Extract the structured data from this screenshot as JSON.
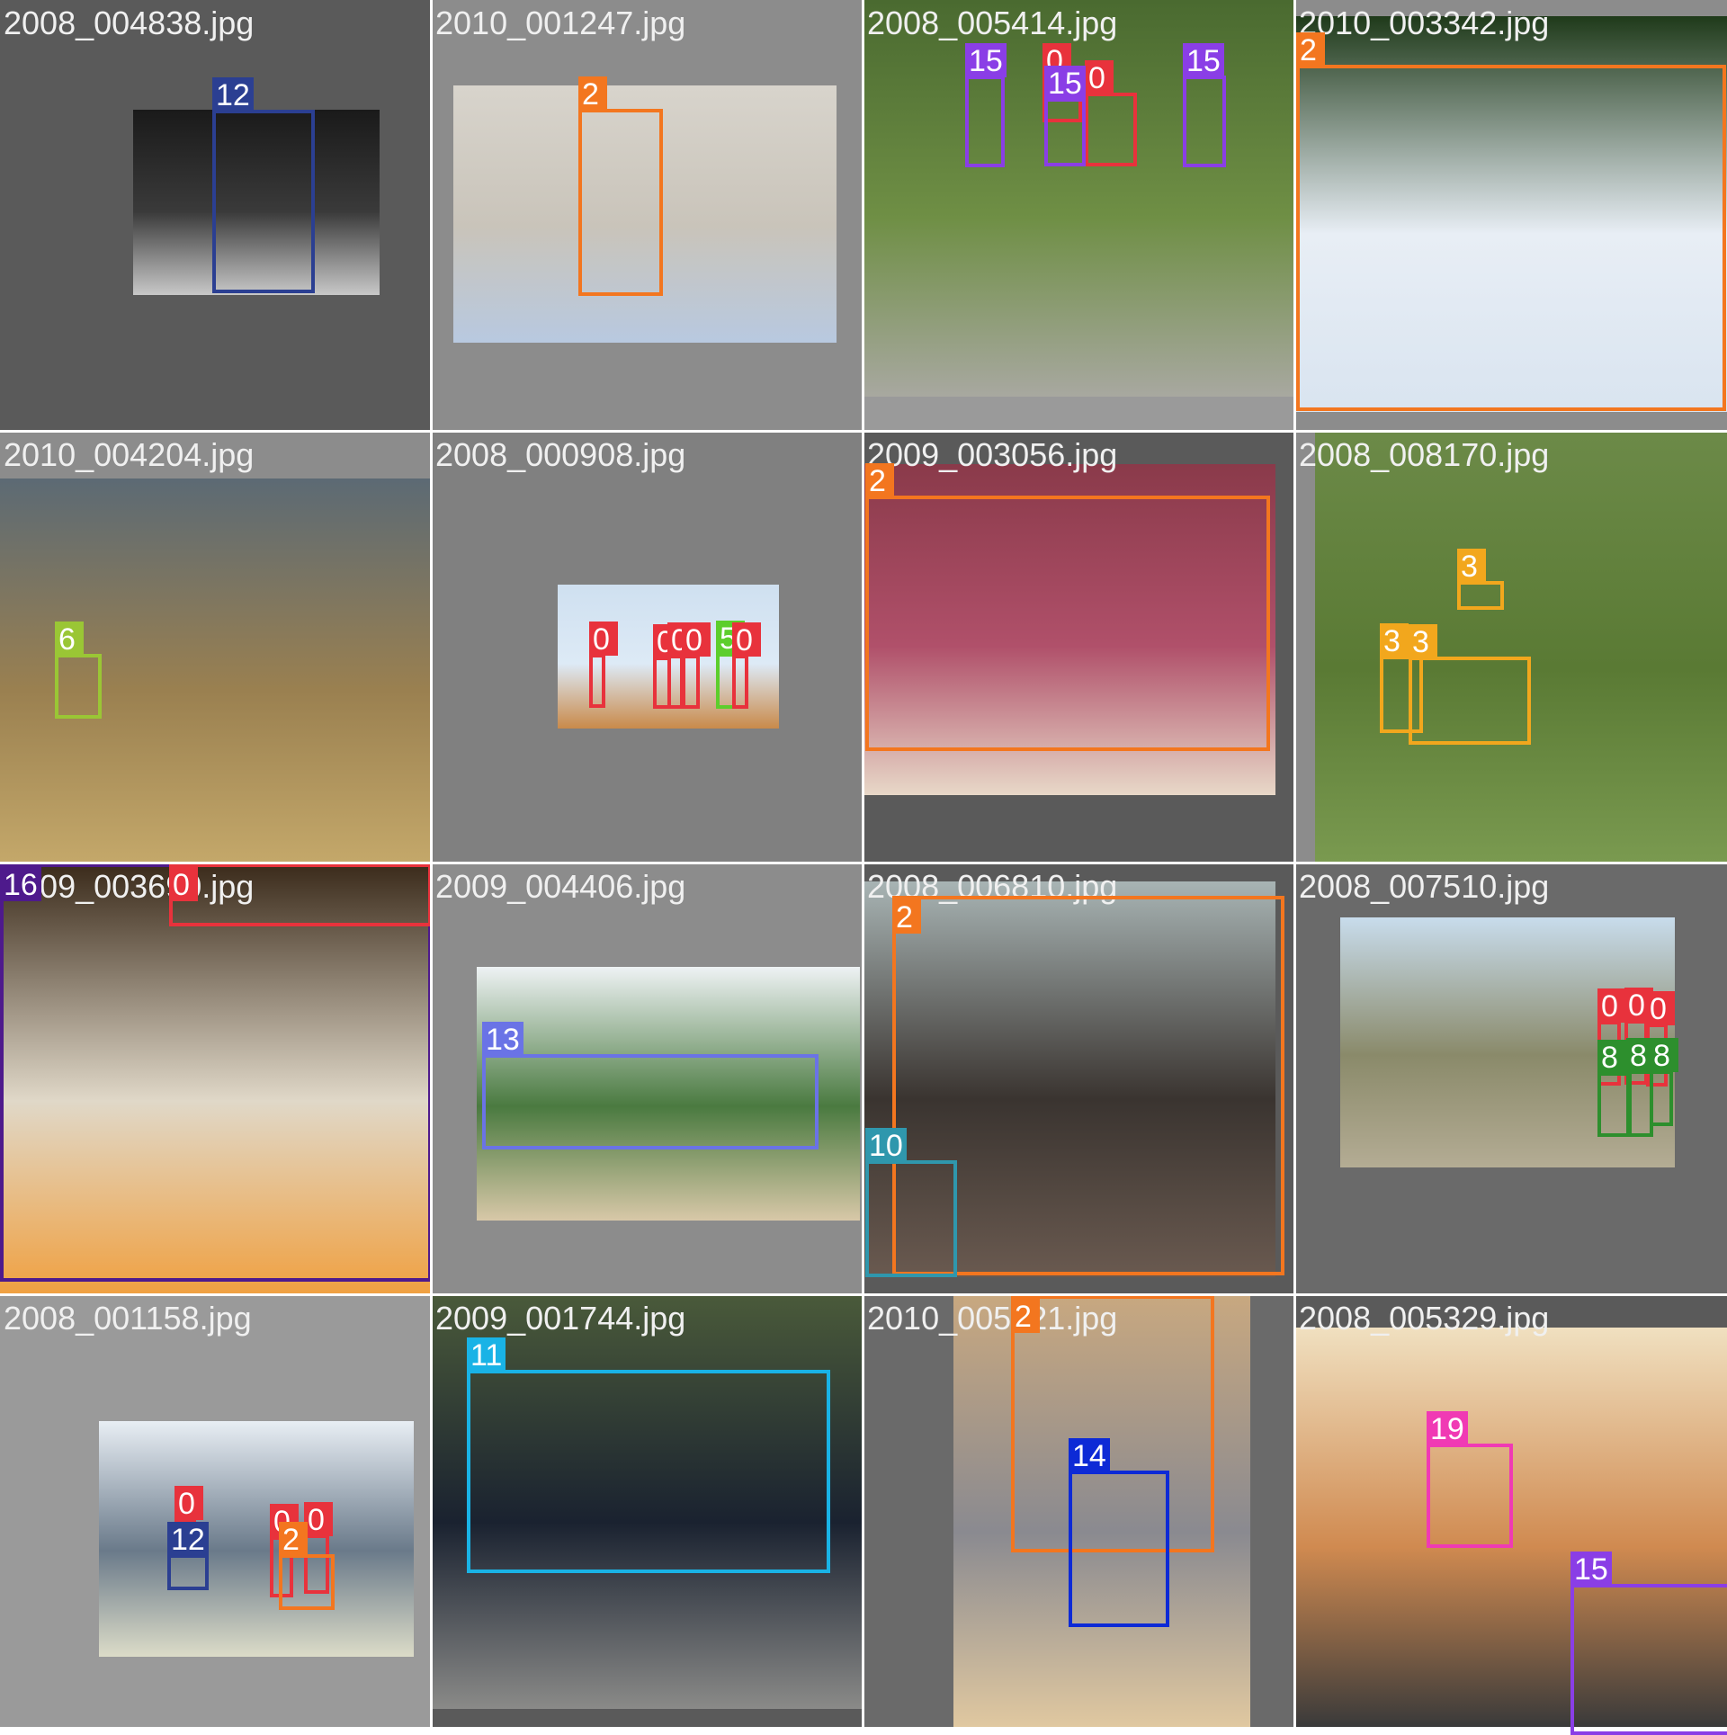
{
  "mosaic": {
    "class_colors": {
      "0": "#e8323c",
      "2": "#f3761f",
      "3": "#f2a71d",
      "5": "#5dce2c",
      "6": "#9ac635",
      "8": "#2d8f2d",
      "10": "#2f97ad",
      "11": "#19b3e6",
      "12": "#2b3f92",
      "13": "#6a73e6",
      "14": "#0d2ad6",
      "15": "#8a3ee6",
      "16": "#4e1a8c",
      "19": "#f03ab4"
    },
    "tiles": [
      {
        "filename": "2008_004838.jpg",
        "bg": "#5a5a5a",
        "photo_colors": [
          "#1a1a1a",
          "#3a3a3a",
          "#c8c8c8"
        ],
        "boxes": [
          {
            "label": "12"
          }
        ]
      },
      {
        "filename": "2010_001247.jpg",
        "bg": "#8c8c8c",
        "photo_colors": [
          "#d8d4cc",
          "#c9c4ba",
          "#b8c9e0"
        ],
        "boxes": [
          {
            "label": "2"
          }
        ]
      },
      {
        "filename": "2008_005414.jpg",
        "bg": "#9a9a9a",
        "photo_colors": [
          "#4a6a30",
          "#6f8f45",
          "#a8a8a0"
        ],
        "boxes": [
          {
            "label": "0"
          },
          {
            "label": "15"
          },
          {
            "label": "0"
          },
          {
            "label": "15"
          },
          {
            "label": "15"
          }
        ]
      },
      {
        "filename": "2010_003342.jpg",
        "bg": "#8c8c8c",
        "photo_colors": [
          "#1f3a1a",
          "#e8eef5",
          "#d9e4f0"
        ],
        "boxes": [
          {
            "label": "2"
          }
        ]
      },
      {
        "filename": "2010_004204.jpg",
        "bg": "#8c8c8c",
        "photo_colors": [
          "#5c6a74",
          "#9a8050",
          "#c4a86a"
        ],
        "boxes": [
          {
            "label": "6"
          }
        ]
      },
      {
        "filename": "2008_000908.jpg",
        "bg": "#808080",
        "photo_colors": [
          "#cfe0f0",
          "#ddeaf6",
          "#c98a4a"
        ],
        "boxes": [
          {
            "label": "0"
          },
          {
            "label": "0"
          },
          {
            "label": "0"
          },
          {
            "label": "0"
          },
          {
            "label": "5"
          },
          {
            "label": "0"
          }
        ]
      },
      {
        "filename": "2009_003056.jpg",
        "bg": "#5a5a5a",
        "photo_colors": [
          "#8a3a4a",
          "#b0506a",
          "#e8d8c8"
        ],
        "boxes": [
          {
            "label": "2"
          }
        ]
      },
      {
        "filename": "2008_008170.jpg",
        "bg": "#8c8c8c",
        "photo_colors": [
          "#6c8a48",
          "#5a7a34",
          "#7a9a50"
        ],
        "boxes": [
          {
            "label": "3"
          },
          {
            "label": "3"
          },
          {
            "label": "3"
          }
        ]
      },
      {
        "filename": "2009_003690.jpg",
        "bg": "#5a5a5a",
        "photo_colors": [
          "#3a2a1a",
          "#e0d8c8",
          "#f0a040"
        ],
        "boxes": [
          {
            "label": "16"
          },
          {
            "label": "0"
          }
        ]
      },
      {
        "filename": "2009_004406.jpg",
        "bg": "#8c8c8c",
        "photo_colors": [
          "#eef2f4",
          "#4a7a40",
          "#d8c8a8"
        ],
        "boxes": [
          {
            "label": "13"
          }
        ]
      },
      {
        "filename": "2008_006810.jpg",
        "bg": "#5a5a5a",
        "photo_colors": [
          "#a8b4b4",
          "#3a3430",
          "#6a5a50"
        ],
        "boxes": [
          {
            "label": "2"
          },
          {
            "label": "10"
          }
        ]
      },
      {
        "filename": "2008_007510.jpg",
        "bg": "#6a6a6a",
        "photo_colors": [
          "#c8dcec",
          "#8a8a6a",
          "#b4ac94"
        ],
        "boxes": [
          {
            "label": "0"
          },
          {
            "label": "0"
          },
          {
            "label": "0"
          },
          {
            "label": "8"
          },
          {
            "label": "8"
          },
          {
            "label": "8"
          }
        ]
      },
      {
        "filename": "2008_001158.jpg",
        "bg": "#9a9a9a",
        "photo_colors": [
          "#e8eef4",
          "#6a7a8a",
          "#dcdcc8"
        ],
        "boxes": [
          {
            "label": "0"
          },
          {
            "label": "12"
          },
          {
            "label": "0"
          },
          {
            "label": "0"
          },
          {
            "label": "2"
          }
        ]
      },
      {
        "filename": "2009_001744.jpg",
        "bg": "#5a5a5a",
        "photo_colors": [
          "#4a5a3a",
          "#1a2230",
          "#8a8a88"
        ],
        "boxes": [
          {
            "label": "11"
          }
        ]
      },
      {
        "filename": "2010_005821.jpg",
        "bg": "#6a6a6a",
        "photo_colors": [
          "#c8a880",
          "#8a8a90",
          "#e0c8a0"
        ],
        "boxes": [
          {
            "label": "2"
          },
          {
            "label": "14"
          }
        ]
      },
      {
        "filename": "2008_005329.jpg",
        "bg": "#5a5a5a",
        "photo_colors": [
          "#f0e0c0",
          "#d08a50",
          "#3a3a3a"
        ],
        "boxes": [
          {
            "label": "19"
          },
          {
            "label": "15"
          }
        ]
      }
    ]
  }
}
